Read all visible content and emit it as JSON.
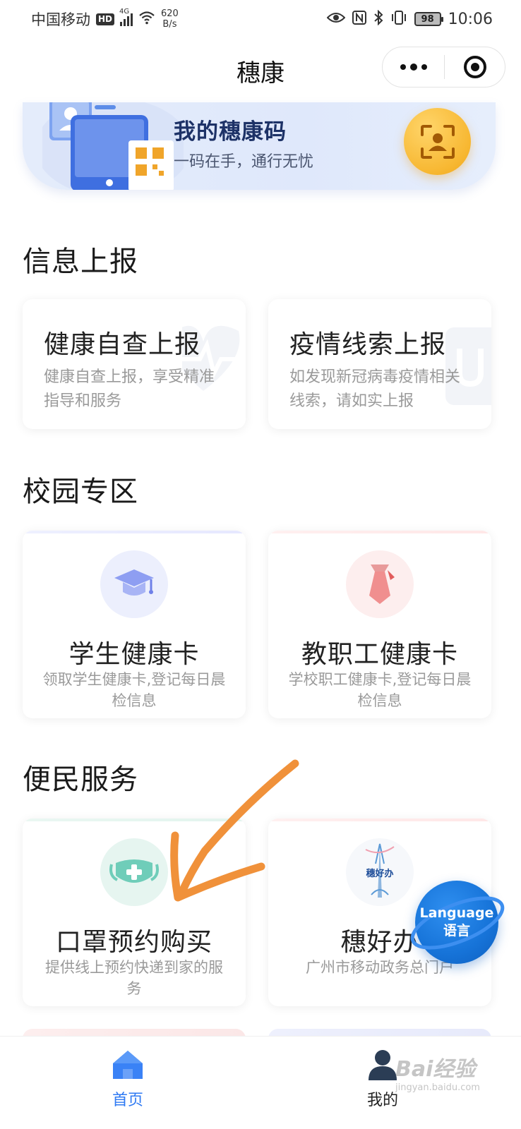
{
  "status_bar": {
    "carrier": "中国移动",
    "hd_label": "HD",
    "network": "4G",
    "speed_value": "620",
    "speed_unit": "B/s",
    "battery": "98",
    "time": "10:06"
  },
  "title_bar": {
    "title": "穗康"
  },
  "health_code": {
    "title": "我的穗康码",
    "subtitle": "一码在手，通行无忧"
  },
  "sections": {
    "report": {
      "title": "信息上报",
      "cards": [
        {
          "title": "健康自查上报",
          "desc": "健康自查上报，享受精准指导和服务"
        },
        {
          "title": "疫情线索上报",
          "desc": "如发现新冠病毒疫情相关线索，请如实上报"
        }
      ]
    },
    "campus": {
      "title": "校园专区",
      "cards": [
        {
          "title": "学生健康卡",
          "desc": "领取学生健康卡,登记每日晨检信息",
          "icon": "graduation-cap-icon"
        },
        {
          "title": "教职工健康卡",
          "desc": "学校职工健康卡,登记每日晨检信息",
          "icon": "necktie-icon"
        }
      ]
    },
    "service": {
      "title": "便民服务",
      "cards": [
        {
          "title": "口罩预约购买",
          "desc": "提供线上预约快递到家的服务",
          "icon": "mask-icon"
        },
        {
          "title": "穗好办",
          "desc": "广州市移动政务总门户",
          "icon": "suihaoban-logo",
          "logo_text": "穗好办"
        }
      ]
    }
  },
  "language_button": {
    "label_en": "Language",
    "label_zh": "语言"
  },
  "tab_bar": {
    "tabs": [
      {
        "label": "首页",
        "active": true
      },
      {
        "label": "我的",
        "active": false
      }
    ]
  },
  "watermark": {
    "text": "Bai经验",
    "url": "jingyan.baidu.com"
  },
  "colors": {
    "accent_blue": "#2f7af3",
    "code_title": "#1d3267",
    "scan_gold": "#f7b731",
    "annotation_orange": "#f0913a",
    "language_blue": "#1673d8"
  }
}
